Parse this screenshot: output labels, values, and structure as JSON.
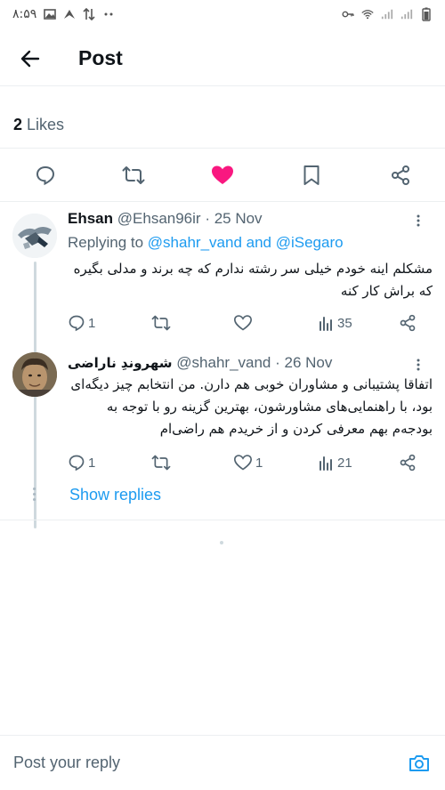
{
  "status_bar": {
    "time": "۸:۵۹"
  },
  "header": {
    "title": "Post"
  },
  "post": {
    "likes_count": "2",
    "likes_label": "Likes"
  },
  "replies": [
    {
      "name": "Ehsan",
      "handle": "@Ehsan96ir",
      "date": "· 25 Nov",
      "replying_prefix": "Replying to",
      "replying_to": "@shahr_vand and @iSegaro",
      "text": "مشکلم اینه خودم خیلی سر رشته ندارم که چه برند و مدلی بگیره که براش کار کنه",
      "reply_count": "1",
      "retweet_count": "",
      "like_count": "",
      "view_count": "35"
    },
    {
      "name": "شهروندِ ناراضی",
      "handle": "@shahr_vand",
      "date": "· 26 Nov",
      "text": "اتفاقا پشتیبانی و مشاوران خوبی هم دارن. من انتخابم چیز دیگه‌ای بود، با راهنمایی‌های مشاورشون، بهترین گزینه رو با توجه به بودجه‌م بهم معرفی کردن و از خریدم هم راضی‌ام",
      "reply_count": "1",
      "retweet_count": "",
      "like_count": "1",
      "view_count": "21"
    }
  ],
  "show_replies_label": "Show replies",
  "reply_bar": {
    "placeholder": "Post your reply"
  },
  "colors": {
    "accent": "#1d9bf0",
    "like": "#f91880",
    "muted": "#536471"
  }
}
